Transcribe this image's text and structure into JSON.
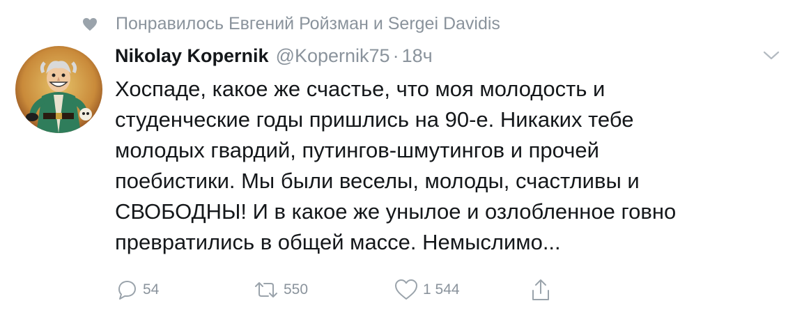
{
  "social_context": {
    "text": "Понравилось Евгений Ройзман и Sergei Davidis",
    "icon": "heart-icon"
  },
  "author": {
    "name": "Nikolay Kopernik",
    "handle": "@Kopernik75",
    "separator": "·",
    "time": "18ч"
  },
  "tweet": {
    "lines": [
      "Хоспаде, какое же счастье, что моя молодость и",
      "студенческие годы пришлись на 90-е. Никаких тебе",
      "молодых гвардий, путингов-шмутингов и прочей",
      "поебистики. Мы были веселы, молоды, счастливы и",
      "СВОБОДНЫ! И в какое же унылое и озлобленное говно",
      "превратились в общей массе. Немыслимо..."
    ]
  },
  "actions": {
    "reply": {
      "icon": "reply-icon",
      "count": "54"
    },
    "retweet": {
      "icon": "retweet-icon",
      "count": "550"
    },
    "like": {
      "icon": "like-icon",
      "count": "1 544"
    },
    "share": {
      "icon": "share-icon"
    }
  },
  "colors": {
    "text": "#14171a",
    "muted": "#8a939c",
    "icon": "#9aa3ab"
  }
}
